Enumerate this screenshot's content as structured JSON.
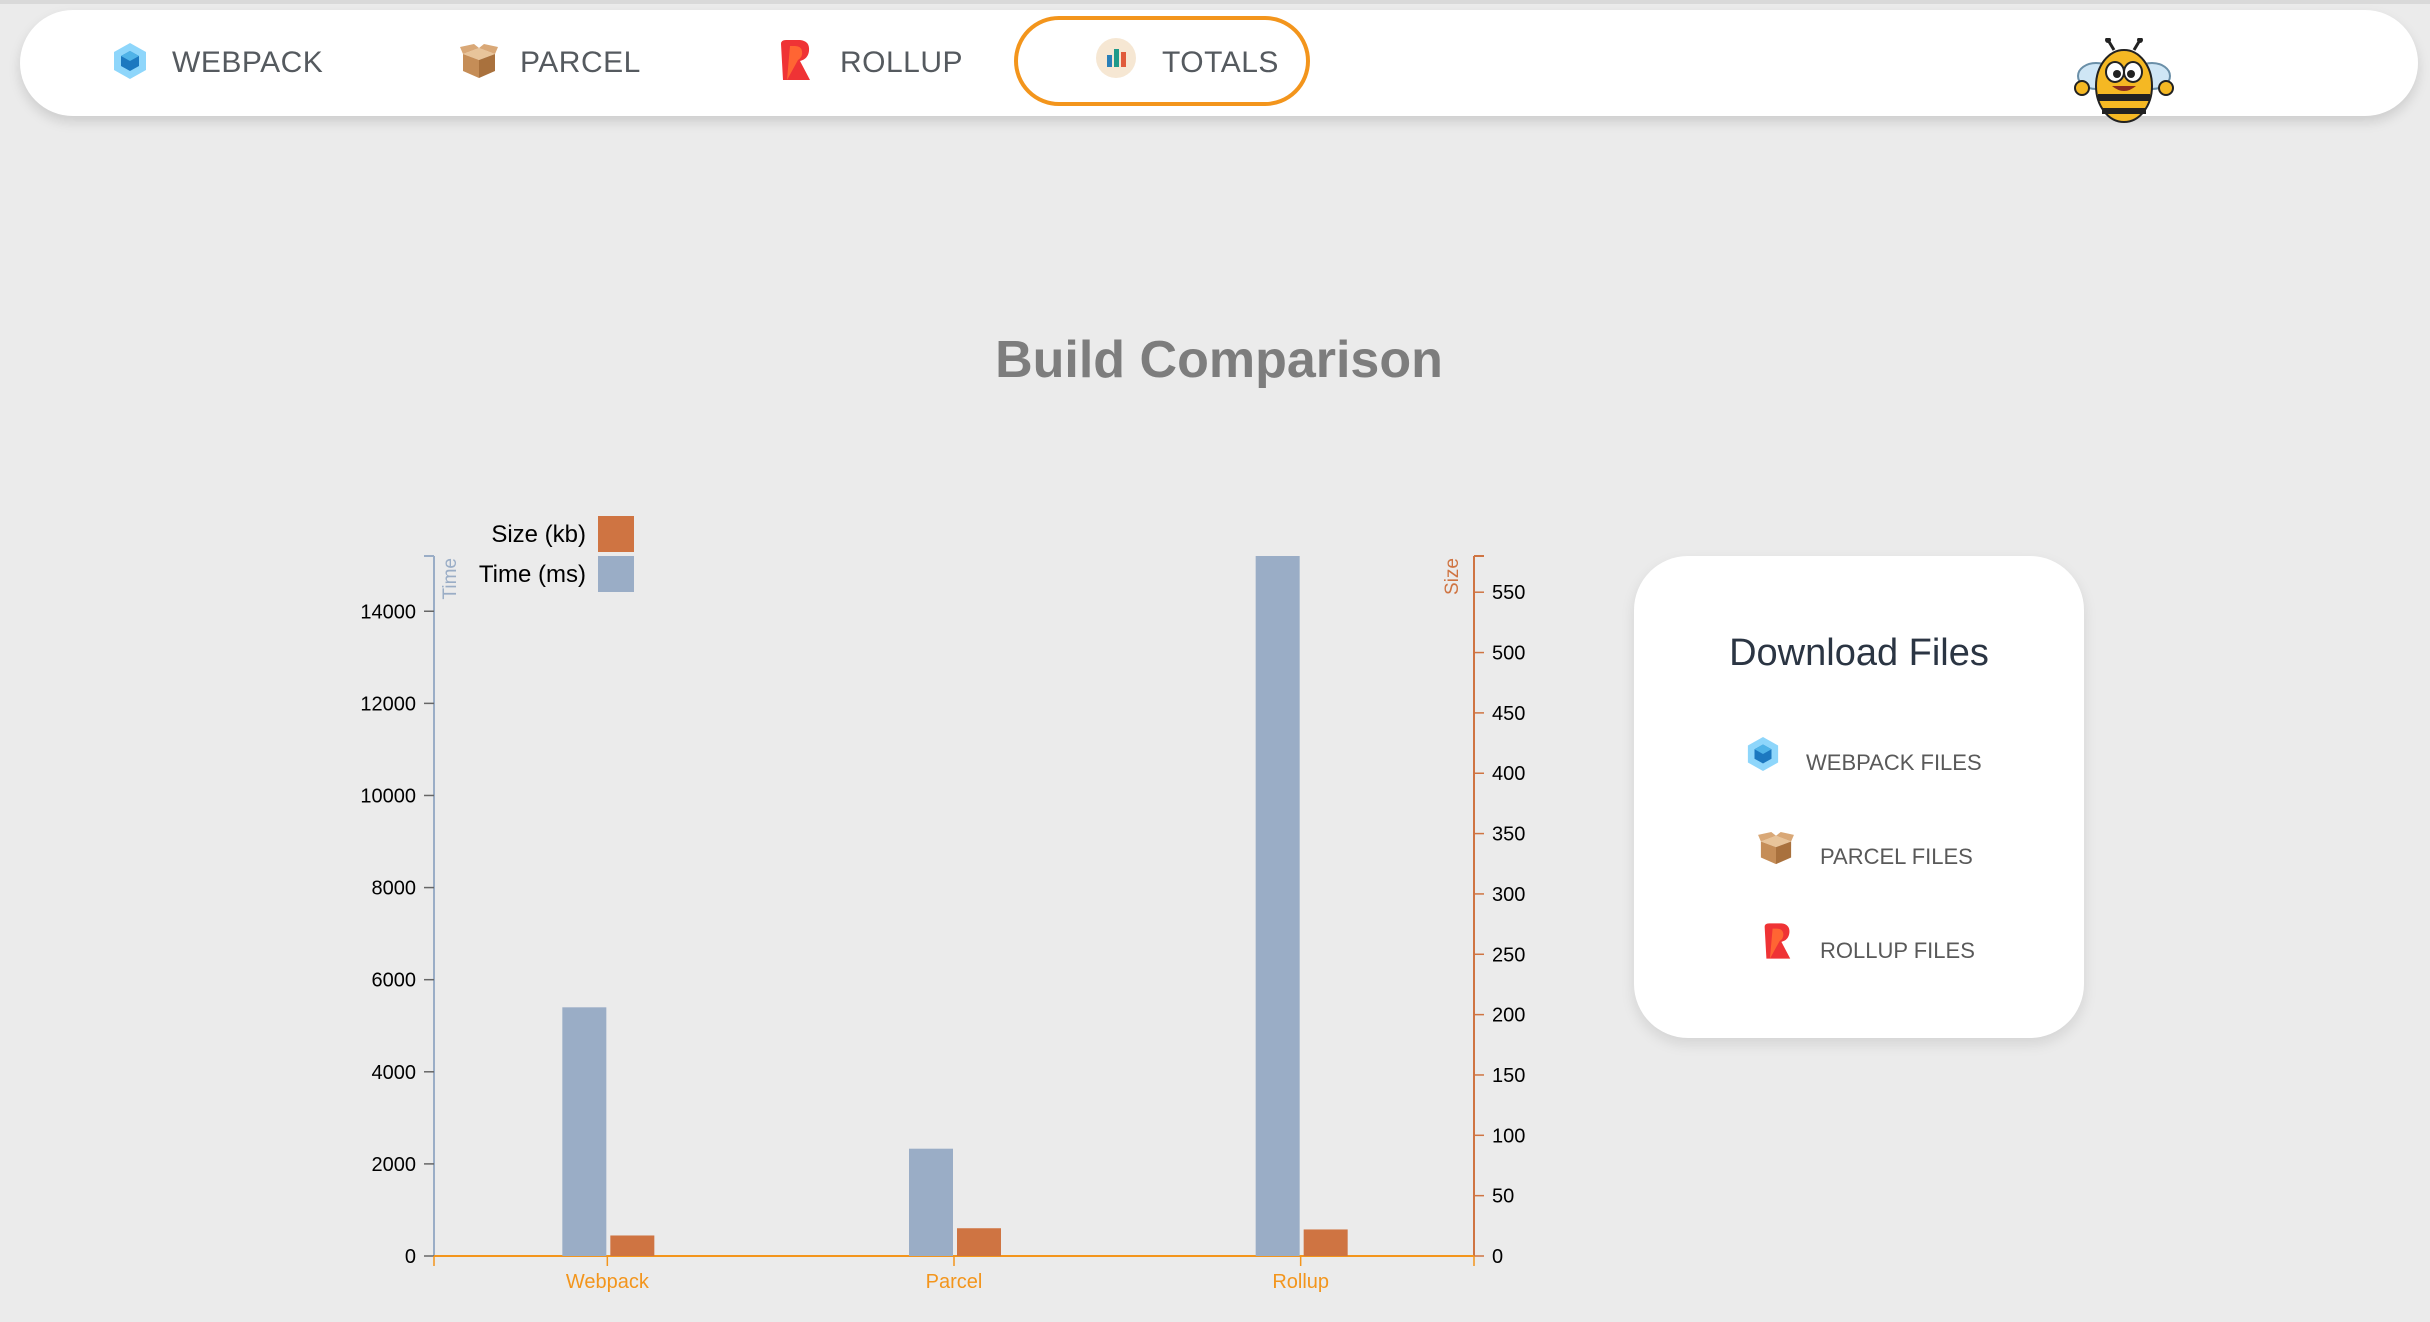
{
  "nav": {
    "items": [
      {
        "label": "WEBPACK",
        "icon": "webpack-cube-icon"
      },
      {
        "label": "PARCEL",
        "icon": "parcel-box-icon"
      },
      {
        "label": "ROLLUP",
        "icon": "rollup-logo-icon"
      },
      {
        "label": "TOTALS",
        "icon": "bar-chart-icon",
        "active": true
      }
    ],
    "mascot_icon": "bee-mascot-icon",
    "active_color": "#f3951c"
  },
  "page_title": "Build Comparison",
  "chart_data": {
    "type": "bar",
    "title": "Build Comparison",
    "categories": [
      "Webpack",
      "Parcel",
      "Rollup"
    ],
    "series": [
      {
        "name": "Time (ms)",
        "axis": "left",
        "color": "#9aadc6",
        "values": [
          5400,
          2330,
          15200
        ]
      },
      {
        "name": "Size (kb)",
        "axis": "right",
        "color": "#cf7442",
        "values": [
          17,
          23,
          22
        ]
      }
    ],
    "left_axis": {
      "label": "Time",
      "ticks": [
        0,
        2000,
        4000,
        6000,
        8000,
        10000,
        12000,
        14000
      ],
      "range": [
        0,
        15200
      ],
      "color": "#9aadc6"
    },
    "right_axis": {
      "label": "Size",
      "ticks": [
        0,
        50,
        100,
        150,
        200,
        250,
        300,
        350,
        400,
        450,
        500,
        550
      ],
      "range": [
        0,
        580
      ],
      "color": "#cf7442"
    },
    "category_color": "#f3951c",
    "legend": [
      {
        "label": "Size (kb)",
        "color": "#cf7442"
      },
      {
        "label": "Time (ms)",
        "color": "#9aadc6"
      }
    ],
    "legend_position": "top-left",
    "grid": false
  },
  "downloads": {
    "title": "Download Files",
    "items": [
      {
        "label": "WEBPACK FILES",
        "icon": "webpack-cube-icon"
      },
      {
        "label": "PARCEL FILES",
        "icon": "parcel-box-icon"
      },
      {
        "label": "ROLLUP FILES",
        "icon": "rollup-logo-icon"
      }
    ]
  }
}
